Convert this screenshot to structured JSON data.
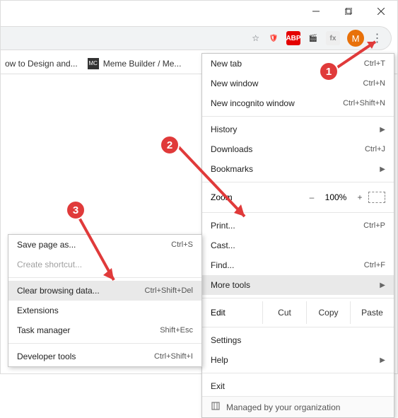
{
  "window": {
    "minimize": "min",
    "maximize": "max",
    "close": "close"
  },
  "toolbar": {
    "star": "☆",
    "ext1": "🛡",
    "ext1_color": "#ff3b30",
    "ext2": "ABP",
    "ext3": "🎬",
    "ext4": "fx",
    "avatar_letter": "M",
    "menu_dots": "⋮"
  },
  "bookmarks": [
    {
      "icon": "",
      "label": "ow to Design and..."
    },
    {
      "icon": "MC",
      "label": "Meme Builder / Me..."
    }
  ],
  "menu": {
    "new_tab": {
      "label": "New tab",
      "shortcut": "Ctrl+T"
    },
    "new_window": {
      "label": "New window",
      "shortcut": "Ctrl+N"
    },
    "new_incognito": {
      "label": "New incognito window",
      "shortcut": "Ctrl+Shift+N"
    },
    "history": {
      "label": "History"
    },
    "downloads": {
      "label": "Downloads",
      "shortcut": "Ctrl+J"
    },
    "bookmarks": {
      "label": "Bookmarks"
    },
    "zoom": {
      "label": "Zoom",
      "minus": "–",
      "value": "100%",
      "plus": "+"
    },
    "print": {
      "label": "Print...",
      "shortcut": "Ctrl+P"
    },
    "cast": {
      "label": "Cast..."
    },
    "find": {
      "label": "Find...",
      "shortcut": "Ctrl+F"
    },
    "more_tools": {
      "label": "More tools"
    },
    "edit": {
      "label": "Edit",
      "cut": "Cut",
      "copy": "Copy",
      "paste": "Paste"
    },
    "settings": {
      "label": "Settings"
    },
    "help": {
      "label": "Help"
    },
    "exit": {
      "label": "Exit"
    },
    "managed": {
      "label": "Managed by your organization"
    }
  },
  "submenu": {
    "save_page": {
      "label": "Save page as...",
      "shortcut": "Ctrl+S"
    },
    "create_shortcut": {
      "label": "Create shortcut..."
    },
    "clear_data": {
      "label": "Clear browsing data...",
      "shortcut": "Ctrl+Shift+Del"
    },
    "extensions": {
      "label": "Extensions"
    },
    "task_manager": {
      "label": "Task manager",
      "shortcut": "Shift+Esc"
    },
    "dev_tools": {
      "label": "Developer tools",
      "shortcut": "Ctrl+Shift+I"
    }
  },
  "badges": {
    "one": "1",
    "two": "2",
    "three": "3"
  }
}
